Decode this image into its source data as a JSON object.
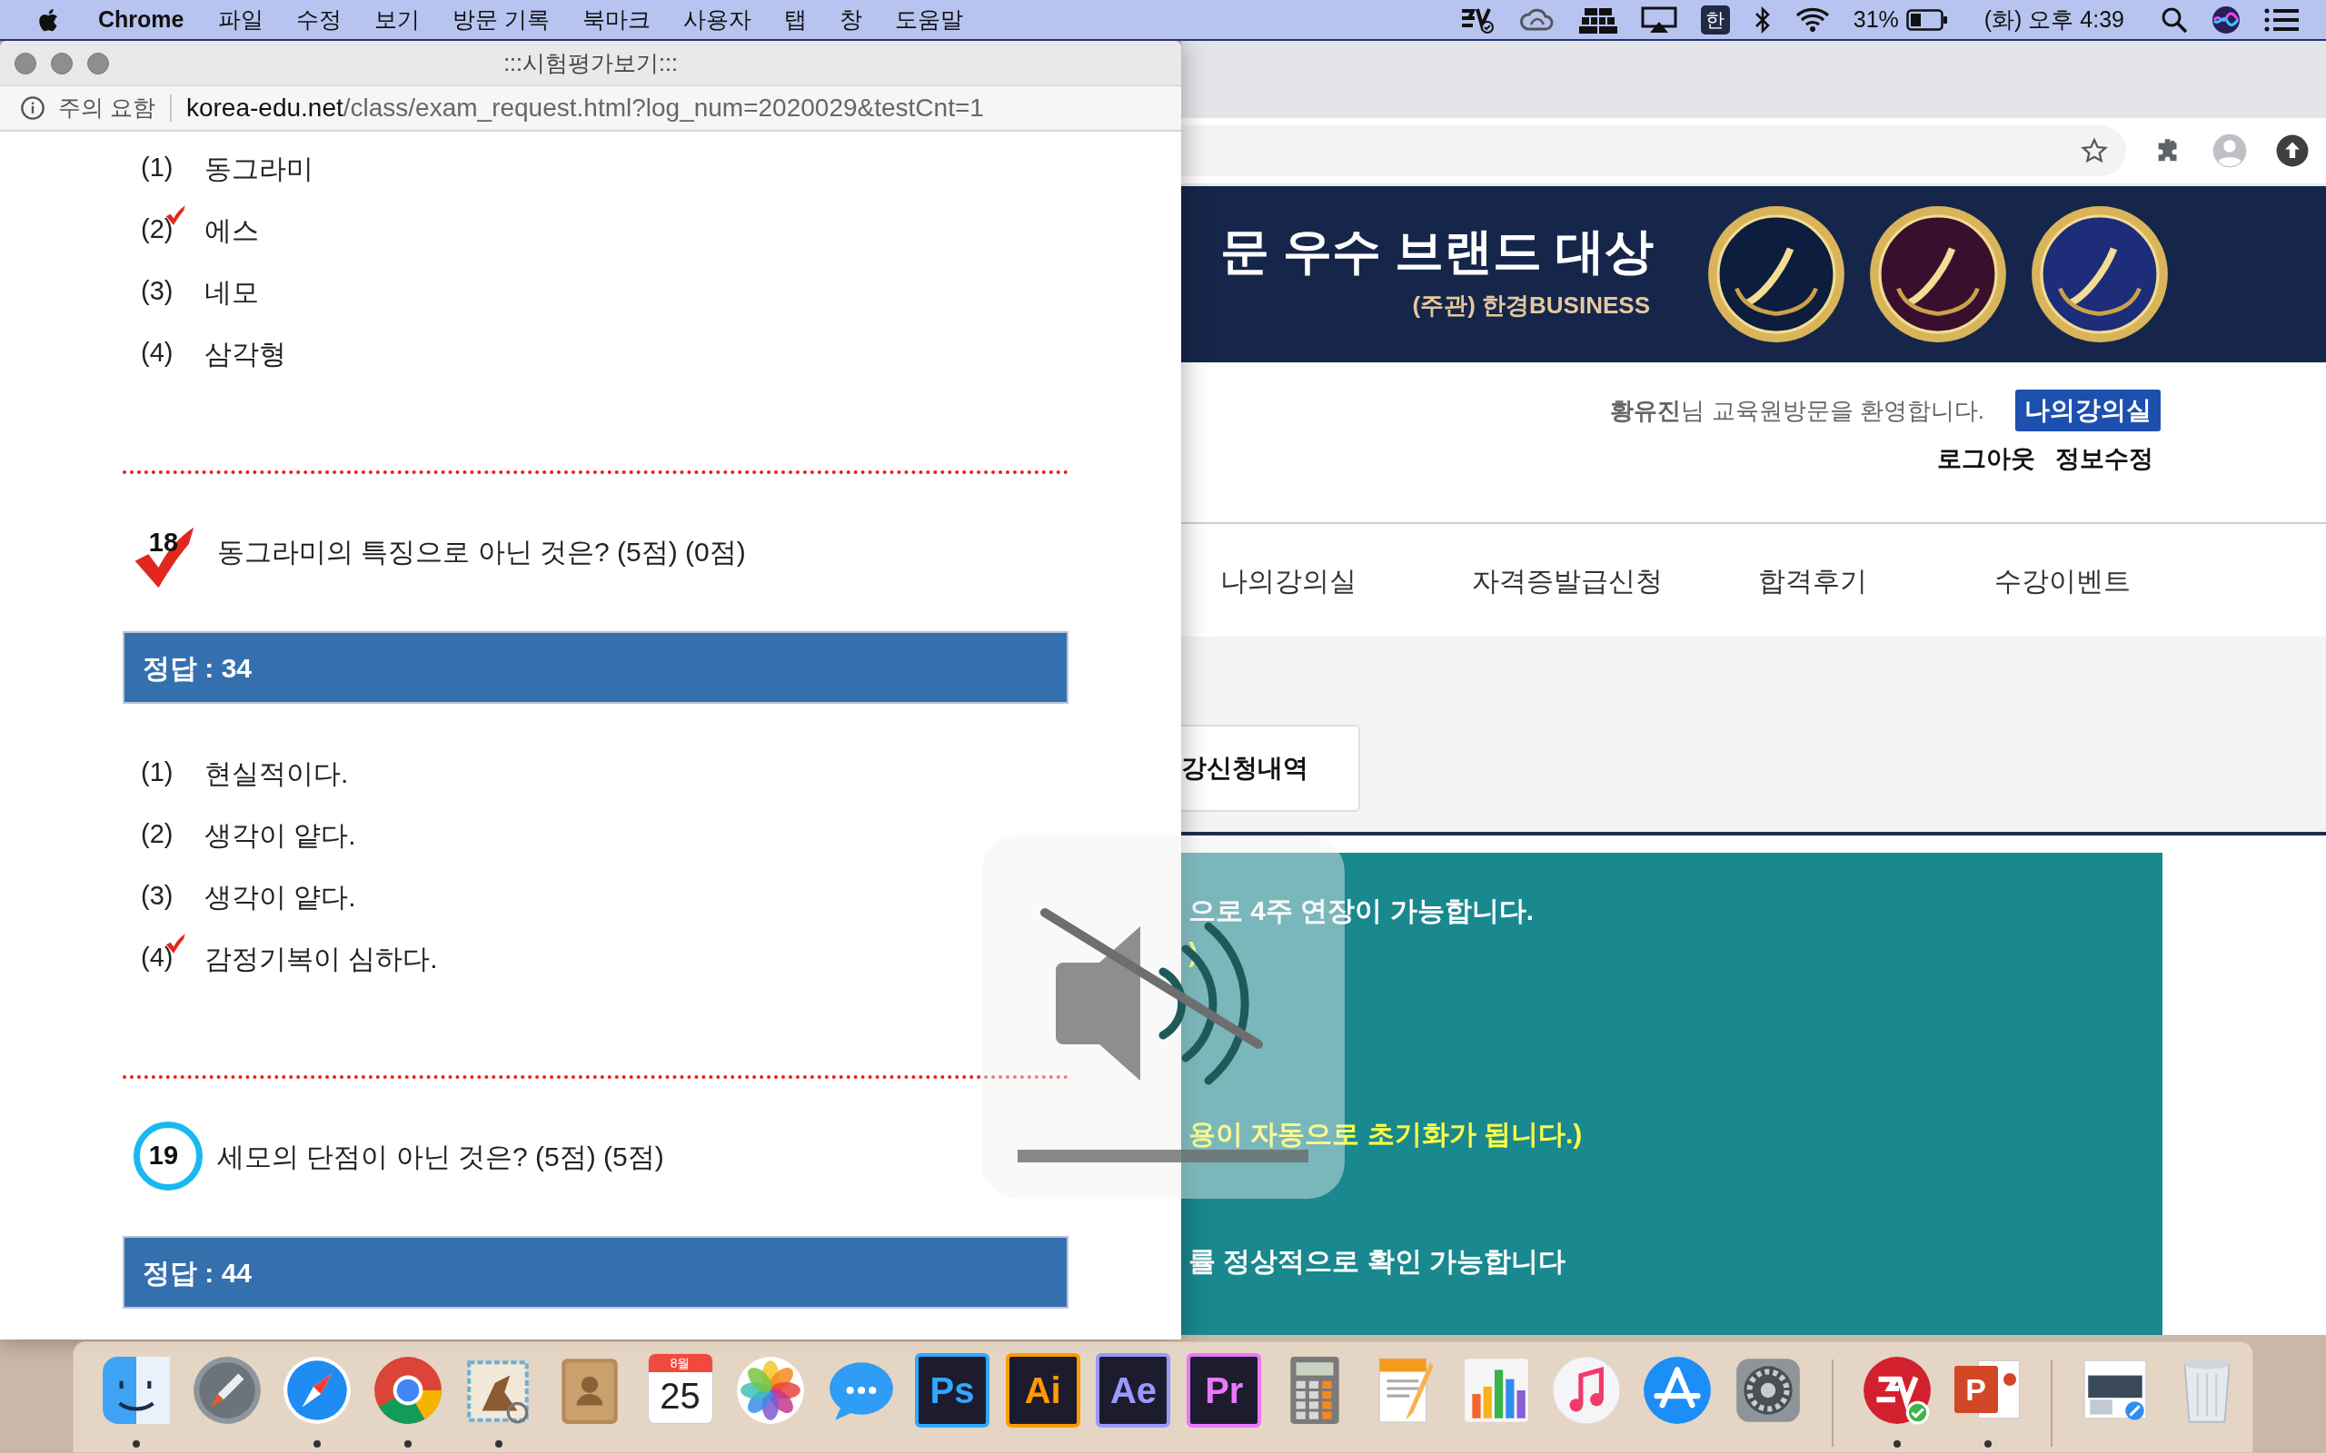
{
  "menu_bar": {
    "app": "Chrome",
    "menus": [
      "파일",
      "수정",
      "보기",
      "방문 기록",
      "북마크",
      "사용자",
      "탭",
      "창",
      "도움말"
    ],
    "input_source": "한",
    "battery_text": "31%",
    "clock": "(화) 오후 4:39"
  },
  "popup": {
    "title": ":::시험평가보기:::",
    "security_label": "주의 요함",
    "url_host": "korea-edu.net",
    "url_path": "/class/exam_request.html?log_num=2020029&testCnt=1",
    "questions": [
      {
        "options": [
          {
            "number": "(1)",
            "text": "동그라미",
            "marked": false
          },
          {
            "number": "(2)",
            "text": "에스",
            "marked": true
          },
          {
            "number": "(3)",
            "text": "네모",
            "marked": false
          },
          {
            "number": "(4)",
            "text": "삼각형",
            "marked": false
          }
        ]
      },
      {
        "number": "18",
        "correct": false,
        "text": "동그라미의 특징으로 아닌 것은? (5점) (0점)",
        "answer": "정답 : 34",
        "options": [
          {
            "number": "(1)",
            "text": "현실적이다.",
            "marked": false
          },
          {
            "number": "(2)",
            "text": "생각이 얕다.",
            "marked": false
          },
          {
            "number": "(3)",
            "text": "생각이 얕다.",
            "marked": false
          },
          {
            "number": "(4)",
            "text": "감정기복이 심하다.",
            "marked": true
          }
        ]
      },
      {
        "number": "19",
        "correct": true,
        "text": "세모의 단점이 아닌 것은? (5점) (5점)",
        "answer": "정답 : 44"
      }
    ]
  },
  "site": {
    "banner_title": "문 우수 브랜드 대상",
    "banner_subtitle": "(주관) 한경BUSINESS",
    "welcome": "**황유진**님 교육원방문을 환영합니다.",
    "classroom_button": "나의강의실",
    "links": [
      "로그아웃",
      "정보수정"
    ],
    "nav": [
      "나의강의실",
      "자격증발급신청",
      "합격후기",
      "수강이벤트"
    ],
    "card_label": "강신청내역",
    "notices": [
      {
        "text": "으로 4주 연장이 가능합니다.",
        "kind": "plain"
      },
      {
        "text": ")",
        "kind": "highlight"
      },
      {
        "text": "용이 자동으로 초기화가 됩니다.)",
        "kind": "highlight"
      },
      {
        "text": "률 정상적으로 확인 가능합니다",
        "kind": "plain"
      }
    ]
  },
  "volume_hud": {
    "muted": true
  },
  "dock": [
    {
      "kind": "finder",
      "running": true
    },
    {
      "kind": "launchpad",
      "running": false
    },
    {
      "kind": "safari",
      "running": true
    },
    {
      "kind": "chrome",
      "running": true
    },
    {
      "kind": "mail",
      "running": true
    },
    {
      "kind": "contacts",
      "running": false
    },
    {
      "kind": "calendar",
      "month": "8월",
      "day": "25",
      "running": false
    },
    {
      "kind": "photos",
      "running": false
    },
    {
      "kind": "messages",
      "running": false
    },
    {
      "kind": "letter",
      "label": "Ps",
      "color": "#31a8ff",
      "running": false
    },
    {
      "kind": "letter",
      "label": "Ai",
      "color": "#ff9a00",
      "running": false
    },
    {
      "kind": "letter",
      "label": "Ae",
      "color": "#9999ff",
      "running": false
    },
    {
      "kind": "letter",
      "label": "Pr",
      "color": "#ea77ff",
      "running": false
    },
    {
      "kind": "calculator",
      "running": false
    },
    {
      "kind": "pages",
      "running": false
    },
    {
      "kind": "numbers",
      "running": false
    },
    {
      "kind": "music",
      "running": false
    },
    {
      "kind": "appstore",
      "running": false
    },
    {
      "kind": "preferences",
      "running": false
    },
    {
      "kind": "separator"
    },
    {
      "kind": "vpn",
      "running": true
    },
    {
      "kind": "powerpoint",
      "label": "P",
      "running": true
    },
    {
      "kind": "separator"
    },
    {
      "kind": "stack",
      "running": false
    },
    {
      "kind": "trash",
      "running": false
    }
  ]
}
